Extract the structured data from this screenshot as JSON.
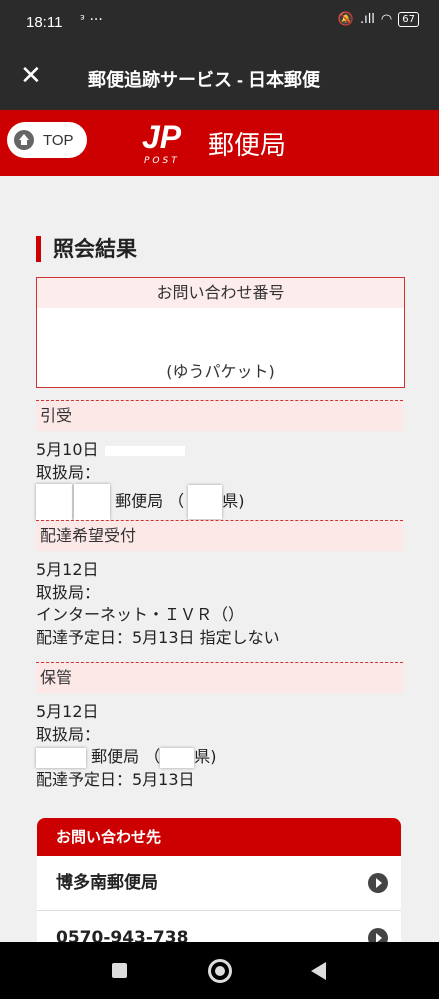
{
  "status_bar": {
    "time": "18:11",
    "extra": "ᵌ ···",
    "battery": "67"
  },
  "title_bar": {
    "close_icon": "close-icon",
    "title": "郵便追跡サービス - 日本郵便"
  },
  "site_header": {
    "top_button": "TOP",
    "logo_mark": "JP",
    "logo_post": "POST",
    "logo_name": "郵便局"
  },
  "result": {
    "heading": "照会結果",
    "inquiry_header": "お問い合わせ番号",
    "package_type": "(ゆうパケット)"
  },
  "events": [
    {
      "status": "引受",
      "date": "5月10日",
      "office_label": "取扱局：",
      "office_name": "郵便局 （",
      "prefecture": "県)"
    },
    {
      "status": "配達希望受付",
      "date": "5月12日",
      "office_label": "取扱局：",
      "office_name": "インターネット・ＩＶＲ（）",
      "scheduled": "配達予定日：5月13日 指定しない"
    },
    {
      "status": "保管",
      "date": "5月12日",
      "office_label": "取扱局：",
      "office_name": "郵便局 （",
      "prefecture": "県)",
      "scheduled": "配達予定日：5月13日"
    }
  ],
  "contact": {
    "header": "お問い合わせ先",
    "office": "博多南郵便局",
    "phone": "0570-943-738"
  },
  "colors": {
    "brand_red": "#cc0000",
    "band_pink": "#fde8e8",
    "dark_bar": "#2b2b2b"
  }
}
